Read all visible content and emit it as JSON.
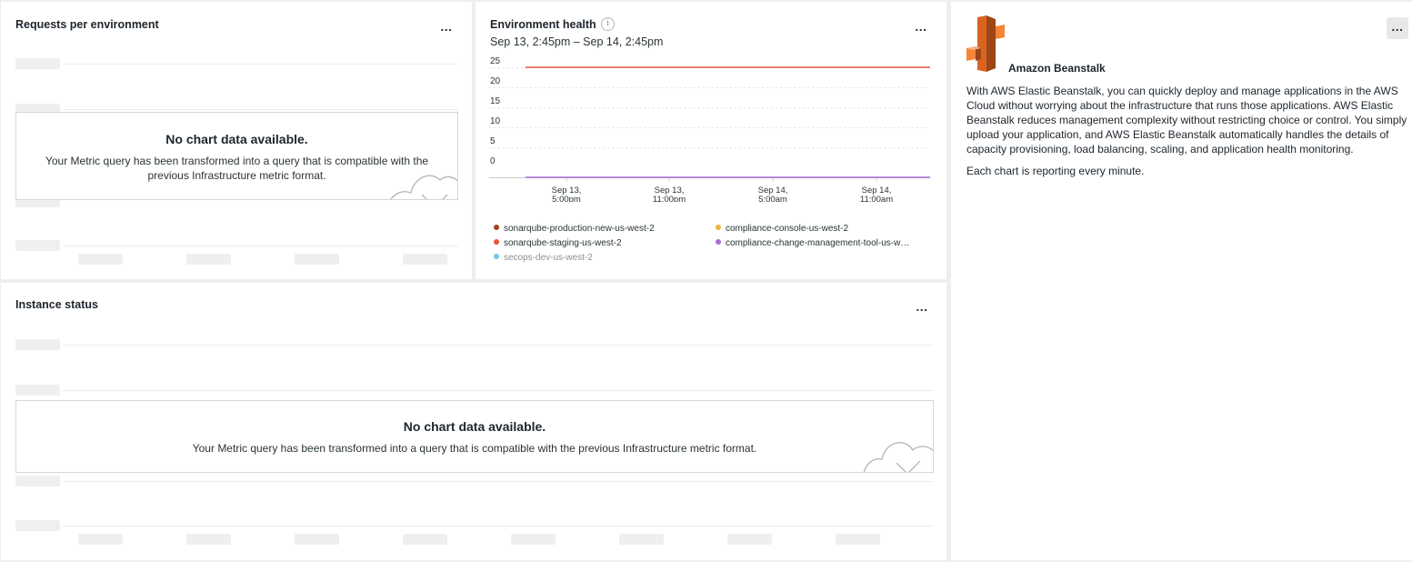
{
  "requests_panel": {
    "title": "Requests per environment",
    "menu_label": "...",
    "no_data": {
      "title": "No chart data available.",
      "message": "Your Metric query has been transformed into a query that is compatible with the previous Infrastructure metric format."
    }
  },
  "health_panel": {
    "title": "Environment health",
    "info_icon": "info-icon",
    "time_range": "Sep 13, 2:45pm – Sep 14, 2:45pm",
    "menu_label": "...",
    "legend": [
      {
        "name": "sonarqube-production-new-us-west-2",
        "color": "#a63f1e"
      },
      {
        "name": "compliance-console-us-west-2",
        "color": "#f2b33b"
      },
      {
        "name": "sonarqube-staging-us-west-2",
        "color": "#e8533a"
      },
      {
        "name": "compliance-change-management-tool-us-w…",
        "color": "#a76bd1"
      },
      {
        "name": "secops-dev-us-west-2",
        "color": "#72c8e8"
      }
    ]
  },
  "instance_panel": {
    "title": "Instance status",
    "menu_label": "...",
    "no_data": {
      "title": "No chart data available.",
      "message": "Your Metric query has been transformed into a query that is compatible with the previous Infrastructure metric format."
    }
  },
  "info_panel": {
    "logo": "aws-elastic-beanstalk-logo",
    "title": "Amazon Beanstalk",
    "menu_label": "...",
    "paragraphs": [
      "With AWS Elastic Beanstalk, you can quickly deploy and manage applications in the AWS Cloud without worrying about the infrastructure that runs those applications. AWS Elastic Beanstalk reduces management complexity without restricting choice or control. You simply upload your application, and AWS Elastic Beanstalk automatically handles the details of capacity provisioning, load balancing, scaling, and application health monitoring.",
      "Each chart is reporting every minute."
    ]
  },
  "chart_data": {
    "type": "line",
    "title": "Environment health",
    "ylim": [
      0,
      25
    ],
    "y_ticks": [
      "25",
      "20",
      "15",
      "10",
      "5",
      "0"
    ],
    "x_ticks": [
      [
        "Sep 13,",
        "5:00pm"
      ],
      [
        "Sep 13,",
        "11:00pm"
      ],
      [
        "Sep 14,",
        "5:00am"
      ],
      [
        "Sep 14,",
        "11:00am"
      ]
    ],
    "series": [
      {
        "name": "sonarqube-staging-us-west-2",
        "color": "#e8533a",
        "values": [
          25,
          25
        ]
      },
      {
        "name": "compliance-change-management-tool-us-w…",
        "color": "#a76bd1",
        "values": [
          0,
          0
        ]
      }
    ]
  }
}
